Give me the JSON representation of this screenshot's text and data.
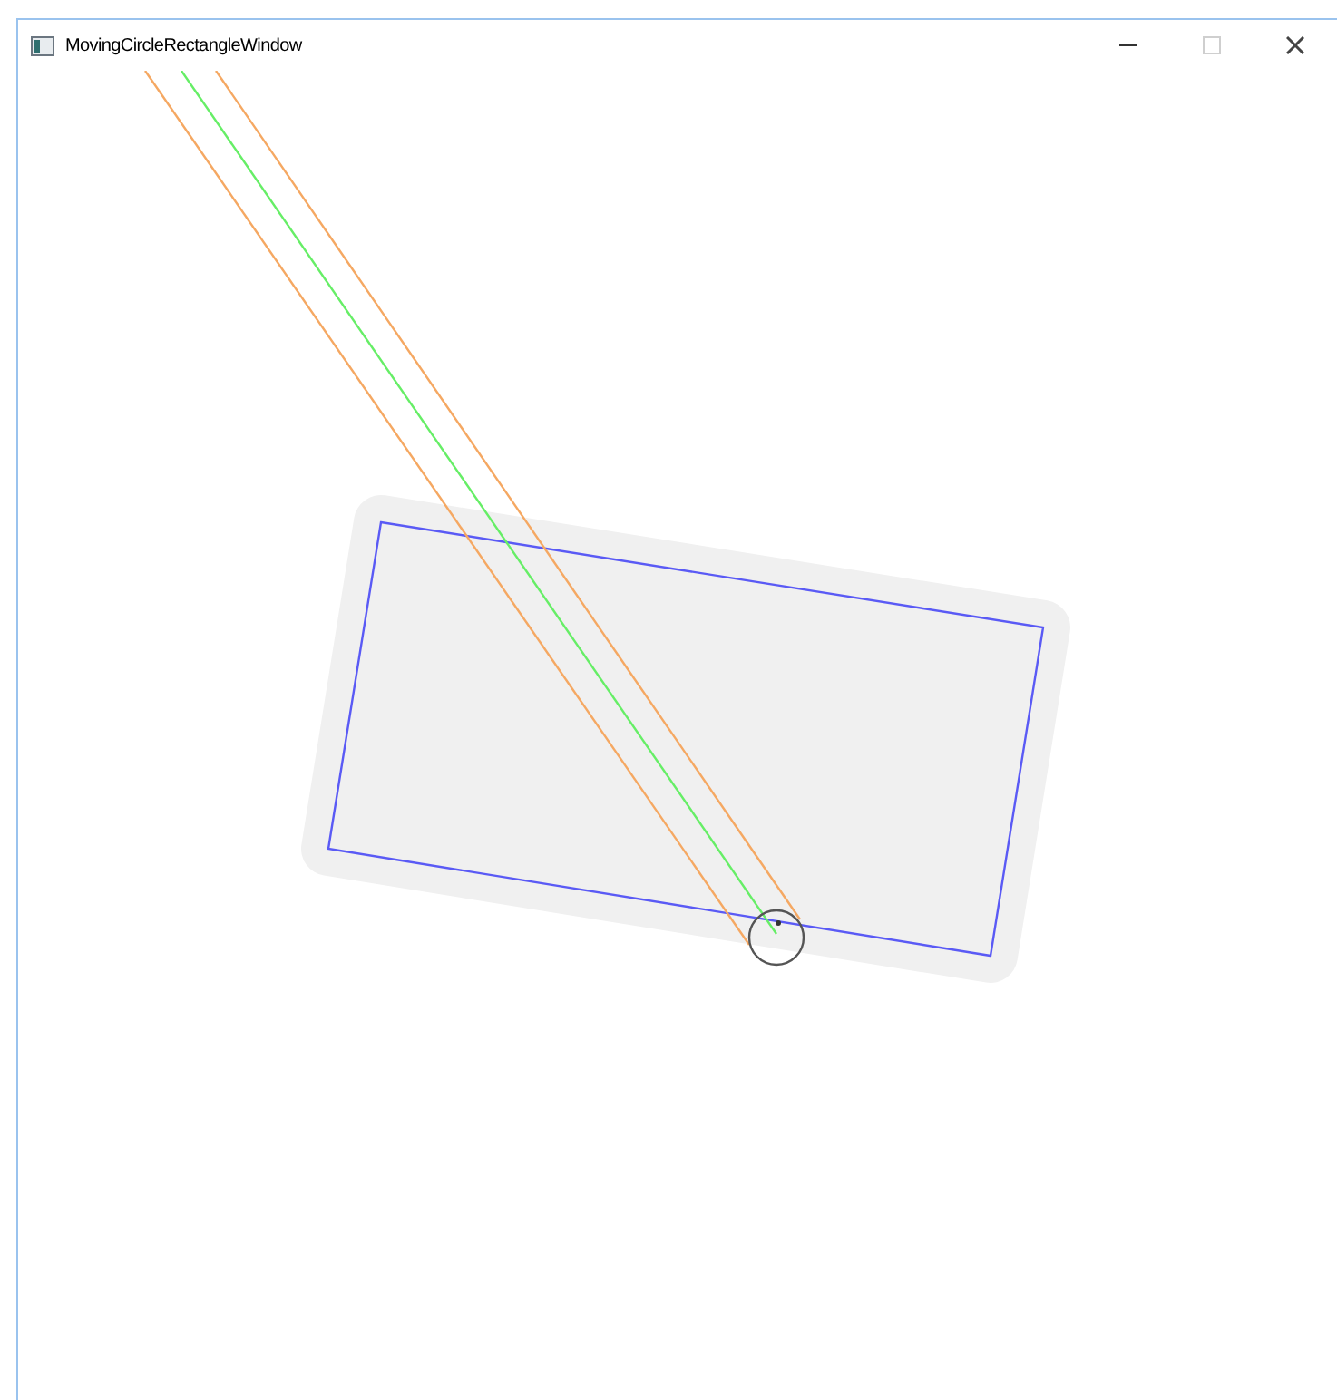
{
  "window": {
    "title": "MovingCircleRectangleWindow"
  }
}
